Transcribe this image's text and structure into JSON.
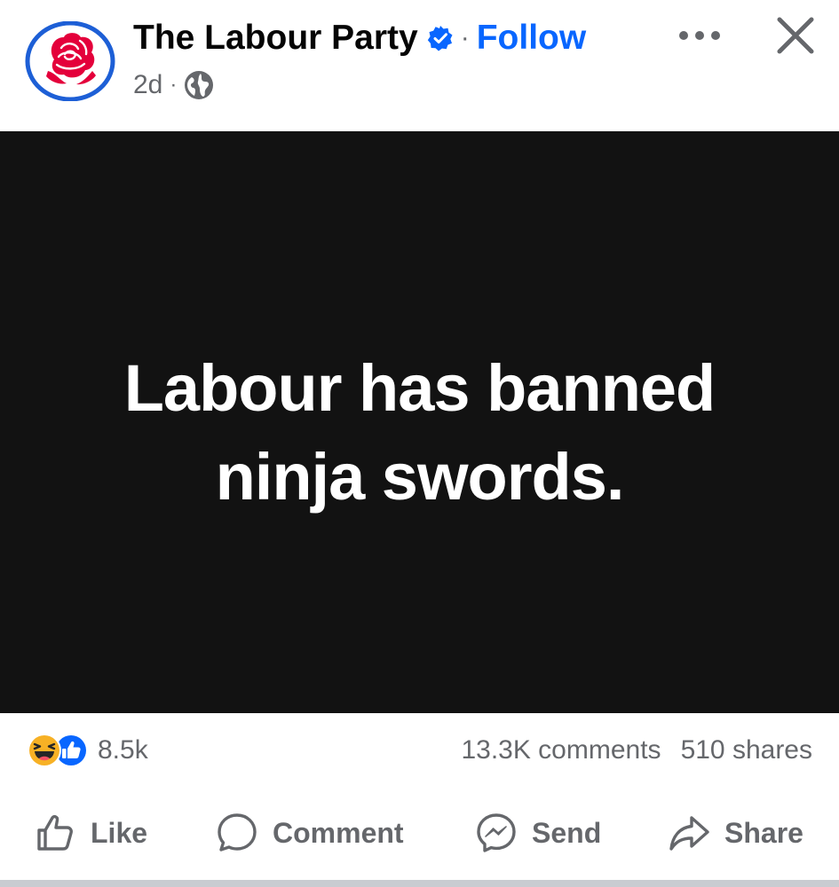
{
  "header": {
    "page_name": "The Labour Party",
    "separator": "·",
    "follow_label": "Follow",
    "time": "2d",
    "time_separator": "·",
    "privacy_icon": "globe-icon",
    "more_icon": "more-horizontal-icon",
    "close_icon": "close-icon"
  },
  "post": {
    "text_line1": "Labour has banned",
    "text_line2": "ninja swords."
  },
  "stats": {
    "reaction_icons": [
      "haha-reaction-icon",
      "like-reaction-icon"
    ],
    "reaction_count": "8.5k",
    "comments": "13.3K comments",
    "shares": "510 shares"
  },
  "actions": {
    "like": "Like",
    "comment": "Comment",
    "send": "Send",
    "share": "Share"
  },
  "colors": {
    "brand_blue": "#0866ff",
    "labour_red": "#e4003b",
    "image_bg": "#121212",
    "secondary_text": "#65676b"
  }
}
